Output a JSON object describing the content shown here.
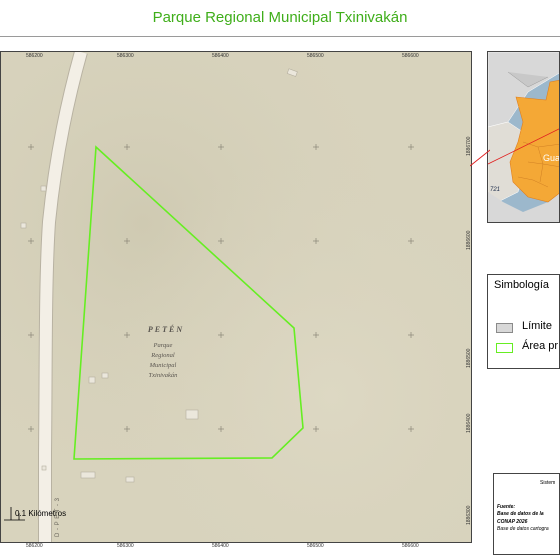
{
  "title": "Parque Regional Municipal Txinivakán",
  "map": {
    "department_label": "PETÉN",
    "area_label_lines": [
      "Parque",
      "Regional",
      "Municipal",
      "Txinivakán"
    ],
    "road_label": "D - P E T - 3",
    "scale_label": "0.1 Kilómetros",
    "x_ticks": [
      "586200",
      "586300",
      "586400",
      "586500",
      "586600"
    ],
    "y_ticks_right": [
      "1886700",
      "1886600",
      "1886500",
      "1886400",
      "1886300"
    ],
    "colors": {
      "boundary": "#66ee22",
      "basemap": "#d8d3bd",
      "road": "#f3efe6"
    }
  },
  "inset": {
    "country_label": "Guate",
    "number_label": "721",
    "colors": {
      "water": "#9cb8cc",
      "country": "#f4a836",
      "neighbor": "#d8d8d8",
      "leader": "#e02020"
    }
  },
  "legend": {
    "title": "Simbología",
    "items": [
      {
        "label": "Límite",
        "swatch": "gray-fill"
      },
      {
        "label": "Área pr",
        "swatch": "green-outline"
      }
    ]
  },
  "info": {
    "system": "Sistem",
    "fuente": "Fuente:",
    "line1": "Base de datos de la",
    "line2": "CONAP 2026",
    "line3": "Base de datos cartogra"
  }
}
